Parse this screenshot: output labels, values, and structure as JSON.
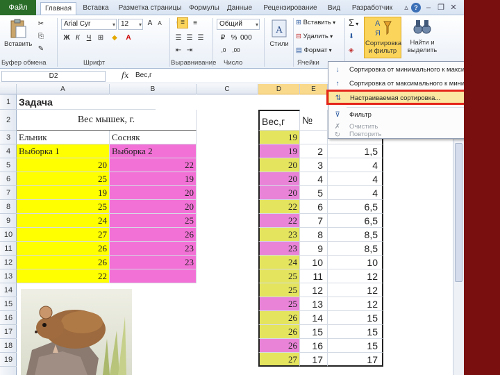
{
  "ribbon": {
    "tabs": [
      "Файл",
      "Главная",
      "Вставка",
      "Разметка страницы",
      "Формулы",
      "Данные",
      "Рецензирование",
      "Вид",
      "Разработчик"
    ],
    "font_name": "Arial Cyr",
    "font_size": "12",
    "number_format": "Общий",
    "paste_label": "Вставить",
    "styles_label": "Стили",
    "insert_label": "Вставить",
    "delete_label": "Удалить",
    "format_label": "Формат",
    "sigma": "Σ",
    "sort_label": "Сортировка и фильтр",
    "find_label": "Найти и выделить",
    "groups": [
      "Буфер обмена",
      "Шрифт",
      "Выравнивание",
      "Число",
      "Ячейки"
    ]
  },
  "formula_bar": {
    "name_box": "D2",
    "fx": "fx",
    "content": "Вес,г"
  },
  "columns": [
    "A",
    "B",
    "C",
    "D",
    "E"
  ],
  "rows": [
    "1",
    "2",
    "3",
    "4",
    "5",
    "6",
    "7",
    "8",
    "9",
    "10",
    "11",
    "12",
    "13",
    "14",
    "15",
    "16",
    "17",
    "18",
    "19"
  ],
  "sheet": {
    "title": "Задача",
    "subtitle": "Вес мышек, г.",
    "col_a_label": "Ельник",
    "col_b_label": "Сосняк",
    "col_a_sample": "Выборка 1",
    "col_b_sample": "Выборка 2",
    "a_values": [
      "20",
      "25",
      "19",
      "25",
      "24",
      "27",
      "26",
      "26",
      "22"
    ],
    "b_values": [
      "22",
      "19",
      "20",
      "20",
      "25",
      "26",
      "23",
      "23"
    ],
    "d_header": "Вес,г",
    "e_header": "№",
    "d_values": [
      "19",
      "19",
      "20",
      "20",
      "20",
      "22",
      "22",
      "23",
      "23",
      "24",
      "25",
      "25",
      "25",
      "26",
      "26",
      "26",
      "27"
    ],
    "e_values": [
      "",
      "2",
      "3",
      "4",
      "5",
      "6",
      "7",
      "8",
      "9",
      "10",
      "11",
      "12",
      "13",
      "14",
      "15",
      "16",
      "17"
    ],
    "f_values": [
      "",
      "1,5",
      "4",
      "4",
      "4",
      "6,5",
      "6,5",
      "8,5",
      "8,5",
      "10",
      "12",
      "12",
      "12",
      "15",
      "15",
      "15",
      "17"
    ]
  },
  "menu": {
    "items": [
      {
        "label": "Сортировка от минимального к максимальному",
        "enabled": true
      },
      {
        "label": "Сортировка от максимального к минимальному",
        "enabled": true
      },
      {
        "label": "Настраиваемая сортировка...",
        "enabled": true,
        "highlighted": true
      },
      {
        "label": "Фильтр",
        "enabled": true
      },
      {
        "label": "Очистить",
        "enabled": false
      },
      {
        "label": "Повторить",
        "enabled": false
      }
    ]
  },
  "colors": {
    "highlight_red": "#e4261b",
    "yellow": "#ffff00",
    "pink": "#f271d6"
  }
}
